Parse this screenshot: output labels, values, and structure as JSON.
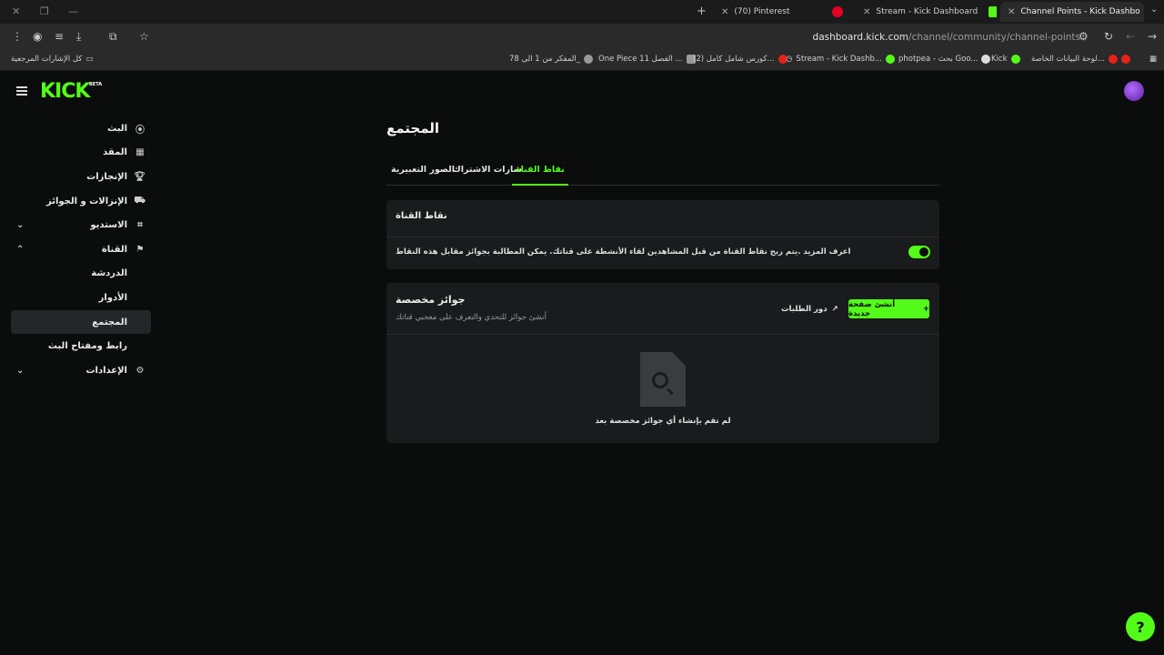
{
  "browser": {
    "tabs": [
      {
        "title": "(70) Pinterest",
        "favicon": "pinterest-icon"
      },
      {
        "title": "Stream - Kick Dashboard",
        "favicon": "kick-icon"
      },
      {
        "title": "Channel Points - Kick Dashbo",
        "favicon": "kick-icon",
        "active": true
      }
    ],
    "url_host": "dashboard.kick.com",
    "url_path": "/channel/community/channel-points",
    "bookmarks": [
      {
        "label": "لوحة البيانات الخاصة...",
        "icon": "youtube-icon"
      },
      {
        "label": "Kick",
        "icon": "kick-icon"
      },
      {
        "label": "photpea - بحث Goo...",
        "icon": "google-icon"
      },
      {
        "label": "Stream - Kick Dashb...",
        "icon": "kick-icon"
      },
      {
        "label": "(2) كورس شامل كامل...",
        "icon": "youtube-icon"
      },
      {
        "label": "One Piece الفصل 11 ...",
        "icon": "manga-icon"
      },
      {
        "label": "المفكر من 1 الى 78_",
        "icon": "globe-icon"
      },
      {
        "label": "كل الإشارات المرجعية",
        "icon": "folder-icon"
      }
    ]
  },
  "app": {
    "logo": "KICK",
    "logo_badge": "BETA",
    "nav": [
      {
        "label": "البث",
        "icon": "live-icon"
      },
      {
        "label": "المقد",
        "icon": "calendar-icon"
      },
      {
        "label": "الإنجازات",
        "icon": "trophy-icon"
      },
      {
        "label": "الإنزالات و الجوائز",
        "icon": "gift-icon"
      },
      {
        "label": "الاستديو",
        "icon": "studio-icon",
        "expandable": true
      },
      {
        "label": "القناة",
        "icon": "channel-icon",
        "expanded": true
      },
      {
        "label": "الدردشة",
        "sub": true
      },
      {
        "label": "الأدوار",
        "sub": true
      },
      {
        "label": "المجتمع",
        "sub": true,
        "active": true
      },
      {
        "label": "رابط ومفتاح البث",
        "sub": true
      },
      {
        "label": "الإعدادات",
        "icon": "settings-icon",
        "expandable": true
      }
    ],
    "page_title": "المجتمع",
    "tabs": [
      "نقاط القناة",
      "شارات الاشتراك",
      "الصور التعبيرية"
    ],
    "channel_points": {
      "header": "نقاط القناة",
      "description": "اعرف المزيد .يتم ربح نقاط القناة من قبل المشاهدين لقاء الأنشطة على قناتك. يمكن المطالبة بجوائز مقابل هذه النقاط",
      "enabled": true
    },
    "custom_rewards": {
      "header": "جوائز مخصصة",
      "subtitle": "أنشئ جوائز للتحدي والتعرف على معجبي قناتك",
      "requests_label": "دور الطلبات",
      "create_label": "أنشئ صفحة جديدة",
      "empty_text": "لم تقم بإنشاء أي جوائز مخصصة بعد"
    }
  },
  "colors": {
    "accent": "#53fc18",
    "background": "#0b0c0c",
    "card": "#191b1c"
  }
}
